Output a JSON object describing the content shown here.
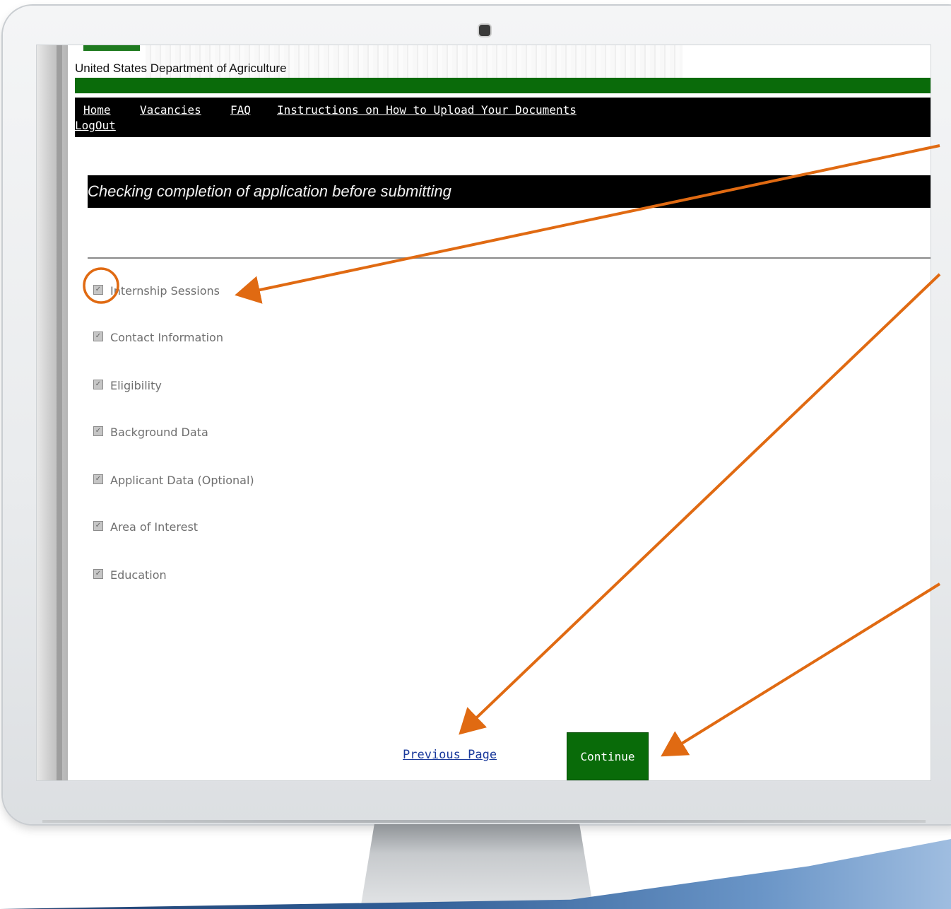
{
  "header": {
    "agency": "United States Department of Agriculture"
  },
  "nav": {
    "items": [
      {
        "label": "Home"
      },
      {
        "label": "Vacancies"
      },
      {
        "label": "FAQ"
      },
      {
        "label": "Instructions on How to Upload Your Documents"
      },
      {
        "label": "LogOut"
      }
    ]
  },
  "main": {
    "title": "Checking completion of application before submitting",
    "checklist": [
      {
        "label": "Internship Sessions",
        "checked": true
      },
      {
        "label": "Contact Information",
        "checked": true
      },
      {
        "label": "Eligibility",
        "checked": true
      },
      {
        "label": "Background Data",
        "checked": true
      },
      {
        "label": "Applicant Data (Optional)",
        "checked": true
      },
      {
        "label": "Area of Interest",
        "checked": true
      },
      {
        "label": "Education",
        "checked": true
      }
    ],
    "previous_label": "Previous Page",
    "continue_label": "Continue"
  },
  "colors": {
    "usda_green": "#0a6b0a",
    "annotation_orange": "#e06a12",
    "link_blue": "#1a3a9c"
  },
  "icons": {
    "checkbox": "checkbox-checked-icon",
    "camera": "camera-icon"
  }
}
